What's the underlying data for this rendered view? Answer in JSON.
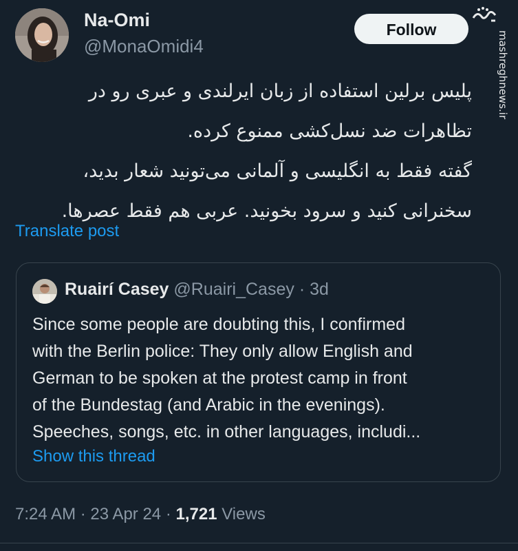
{
  "author": {
    "display_name": "Na-Omi",
    "handle": "@MonaOmidi4"
  },
  "follow_label": "Follow",
  "watermark": {
    "logo_text": "مشرق",
    "url": "mashreghnews.ir"
  },
  "post": {
    "lines": [
      "پلیس برلین استفاده از زبان ایرلندی و عبری رو در",
      "تظاهرات ضد نسل‌کشی ممنوع کرده.",
      "گفته فقط به انگلیسی و آلمانی می‌تونید شعار بدید،",
      "سخنرانی کنید و سرود بخونید. عربی هم فقط عصرها."
    ],
    "translate_label": "Translate post"
  },
  "quote": {
    "display_name": "Ruairí Casey",
    "handle": "@Ruairi_Casey",
    "separator": "·",
    "time": "3d",
    "lines": [
      "Since some people are doubting this, I confirmed",
      "with the Berlin police: They only allow English and",
      "German to be spoken at the protest camp in front",
      "of the Bundestag (and Arabic in the evenings).",
      "Speeches, songs, etc. in other languages, includi..."
    ],
    "show_thread_label": "Show this thread"
  },
  "meta": {
    "time": "7:24 AM",
    "separator": "·",
    "date": "23 Apr 24",
    "views_count": "1,721",
    "views_label": "Views"
  },
  "colors": {
    "background": "#15202b",
    "text_primary": "#e7e9ea",
    "text_secondary": "#8b98a5",
    "link": "#1d9bf0",
    "border": "#38444d",
    "follow_button_bg": "#eff3f4"
  }
}
